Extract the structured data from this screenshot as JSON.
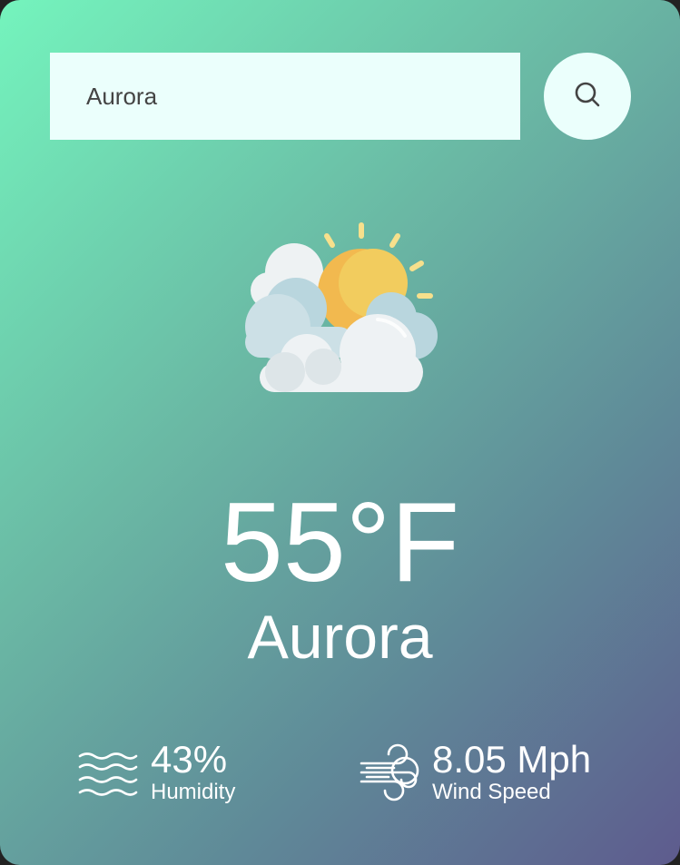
{
  "search": {
    "value": "Aurora",
    "placeholder": "",
    "icon": "search-icon"
  },
  "weather": {
    "icon": "partly-cloudy-icon",
    "temperature": "55°F",
    "city": "Aurora"
  },
  "details": {
    "humidity": {
      "value": "43%",
      "label": "Humidity",
      "icon": "humidity-icon"
    },
    "wind": {
      "value": "8.05 Mph",
      "label": "Wind Speed",
      "icon": "wind-icon"
    }
  },
  "colors": {
    "gradient_start": "#74f4bd",
    "gradient_end": "#5e5b8e",
    "input_bg": "#ebfffc",
    "text": "#ffffff"
  }
}
